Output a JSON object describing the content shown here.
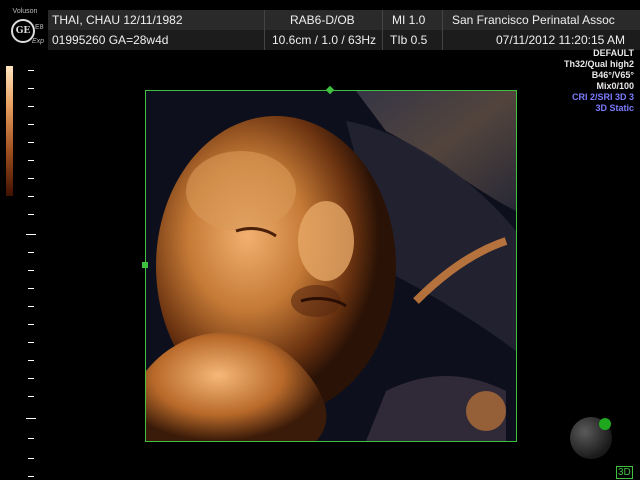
{
  "header": {
    "brand": "Voluson",
    "logo": "GE",
    "model": "E8",
    "mode": "Exp",
    "patient_name_date": "THAI, CHAU  12/11/1982",
    "probe": "RAB6-D/OB",
    "mi": "MI  1.0",
    "institution": "San Francisco Perinatal Assoc",
    "patient_id_ga": "01995260  GA=28w4d",
    "depth_freq": "10.6cm / 1.0 / 63Hz",
    "tib": "TIb  0.5",
    "datetime": "07/11/2012   11:20:15 AM"
  },
  "right_panel": {
    "lines": [
      {
        "text": "DEFAULT",
        "color": "white"
      },
      {
        "text": "Th32/Qual high2",
        "color": "white"
      },
      {
        "text": "B46°/V65°",
        "color": "white"
      },
      {
        "text": "Mix0/100",
        "color": "white"
      },
      {
        "text": "CRI 2/SRI 3D 3",
        "color": "blue"
      },
      {
        "text": "3D Static",
        "color": "blue"
      }
    ]
  },
  "viewer": {
    "label_3d": "3D",
    "accent_color": "#3fc03f"
  }
}
